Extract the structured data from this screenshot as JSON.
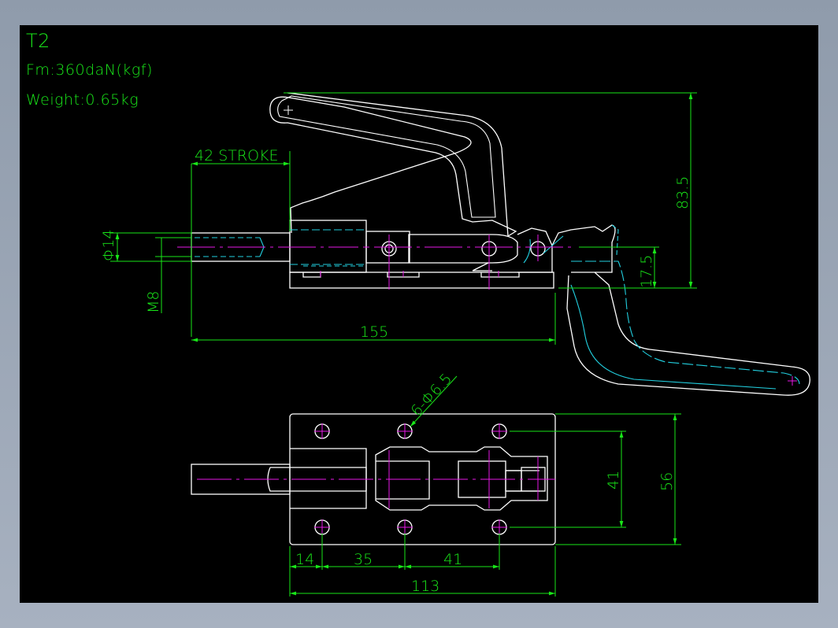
{
  "drawing": {
    "title": "T2",
    "force": "Fm:360daN(kgf)",
    "weight": "Weight:0.65kg",
    "colors": {
      "background": "#000000",
      "outline": "#ffffff",
      "dimension": "#19e619",
      "centerline": "#e619e6",
      "hidden": "#22d0e0"
    }
  },
  "dimensions": {
    "stroke": "42 STROKE",
    "rod_diameter": "Φ14",
    "thread": "M8",
    "overall_length": "155",
    "handle_height": "83.5",
    "rod_height": "17.5",
    "holes": "6-Φ6.5",
    "hole_span": "41",
    "base_width": "56",
    "edge_offset": "14",
    "pitch_1": "35",
    "pitch_2": "41",
    "base_length": "113"
  }
}
